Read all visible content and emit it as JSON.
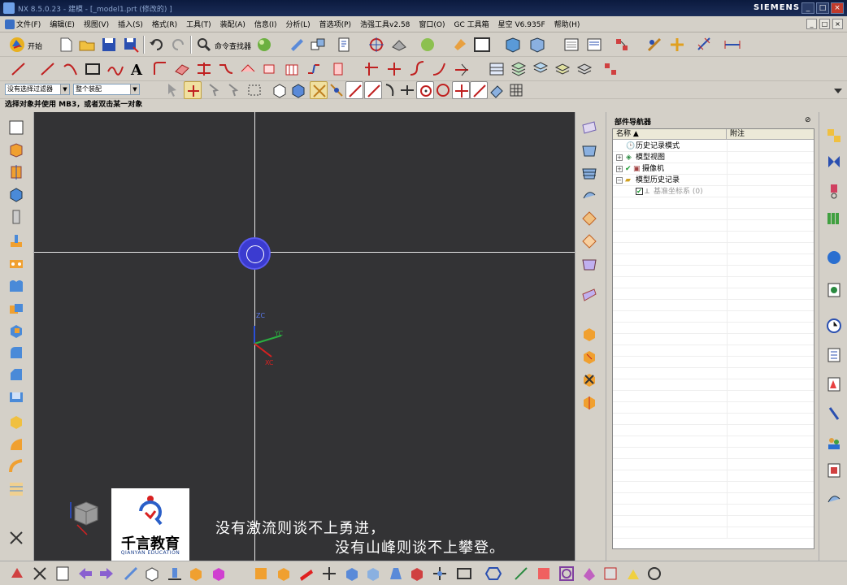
{
  "window": {
    "title": "NX 8.5.0.23 - 建模 - [_model1.prt  (修改的) ]",
    "brand": "SIEMENS",
    "min": "_",
    "max": "□",
    "close": "×"
  },
  "menu": {
    "items": [
      "文件(F)",
      "编辑(E)",
      "视图(V)",
      "插入(S)",
      "格式(R)",
      "工具(T)",
      "装配(A)",
      "信息(I)",
      "分析(L)",
      "首选项(P)",
      "浩强工具v2.58",
      "窗口(O)",
      "GC 工具箱",
      "星空 V6.935F",
      "帮助(H)"
    ],
    "mdi_buttons": [
      "_",
      "□",
      "×"
    ]
  },
  "toolbar1": {
    "start_label": "开始",
    "command_finder_label": "命令查找器"
  },
  "selection_bar": {
    "filter_value": "没有选择过滤器",
    "scope_value": "整个装配"
  },
  "status_prompt": "选择对象并使用 MB3，或者双击某一对象",
  "viewport": {
    "axis_labels": {
      "zc": "ZC",
      "yc": "YC",
      "xc": "XC"
    },
    "subtitle_line1": "没有激流则谈不上勇进，",
    "subtitle_line2": "没有山峰则谈不上攀登。",
    "logo": {
      "cn": "千言教育",
      "en": "QIANYAN EDUCATION"
    }
  },
  "navigator": {
    "title": "部件导航器",
    "pin": "⊘",
    "columns": [
      "名称  ▲",
      "附注"
    ],
    "rows": [
      {
        "label": "历史记录模式",
        "expander": "",
        "check": false,
        "icon": "clock-icon",
        "indent": 1
      },
      {
        "label": "模型视图",
        "expander": "+",
        "check": false,
        "icon": "model-views-icon",
        "indent": 1
      },
      {
        "label": "摄像机",
        "expander": "+",
        "check": true,
        "icon": "camera-icon",
        "indent": 1
      },
      {
        "label": "模型历史记录",
        "expander": "−",
        "check": false,
        "icon": "folder-icon",
        "indent": 1
      },
      {
        "label": "基准坐标系 (0)",
        "expander": "",
        "check": true,
        "icon": "datum-csys-icon",
        "indent": 2
      }
    ]
  },
  "colors": {
    "viewport_bg": "#333335",
    "wcs_handle": "#3b3bd0",
    "title_bar": "#0b1a3e",
    "ui_face": "#d4d0c8"
  }
}
